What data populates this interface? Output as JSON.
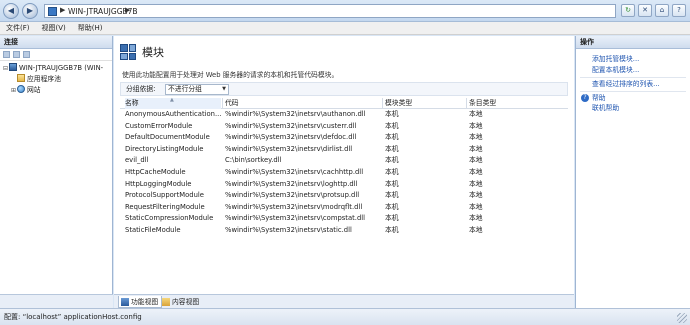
{
  "address": {
    "path": "WIN-JTRAUJGGB7B",
    "separator": "▶",
    "trailing_separator": "▶"
  },
  "menu": [
    "文件(F)",
    "视图(V)",
    "帮助(H)"
  ],
  "connections": {
    "header": "连接",
    "tree": [
      {
        "label": "WIN-JTRAUJGGB7B (WIN-",
        "expander": "⊟",
        "icon": "server-icon"
      },
      {
        "label": "应用程序池",
        "expander": "",
        "icon": "folder-icon"
      },
      {
        "label": "网站",
        "expander": "⊞",
        "icon": "sites-icon"
      }
    ]
  },
  "main": {
    "title": "模块",
    "description": "使用此功能配置用于处理对 Web 服务器的请求的本机和托管代码模块。",
    "group_by_label": "分组依据:",
    "group_by_value": "不进行分组",
    "columns": [
      "名称",
      "代码",
      "模块类型",
      "条目类型"
    ],
    "rows": [
      [
        "AnonymousAuthentication...",
        "%windir%\\System32\\inetsrv\\authanon.dll",
        "本机",
        "本地"
      ],
      [
        "CustomErrorModule",
        "%windir%\\System32\\inetsrv\\custerr.dll",
        "本机",
        "本地"
      ],
      [
        "DefaultDocumentModule",
        "%windir%\\System32\\inetsrv\\defdoc.dll",
        "本机",
        "本地"
      ],
      [
        "DirectoryListingModule",
        "%windir%\\System32\\inetsrv\\dirlist.dll",
        "本机",
        "本地"
      ],
      [
        "evil_dll",
        "C:\\bin\\sortkey.dll",
        "本机",
        "本地"
      ],
      [
        "HttpCacheModule",
        "%windir%\\System32\\inetsrv\\cachhttp.dll",
        "本机",
        "本地"
      ],
      [
        "HttpLoggingModule",
        "%windir%\\System32\\inetsrv\\loghttp.dll",
        "本机",
        "本地"
      ],
      [
        "ProtocolSupportModule",
        "%windir%\\System32\\inetsrv\\protsup.dll",
        "本机",
        "本地"
      ],
      [
        "RequestFilteringModule",
        "%windir%\\System32\\inetsrv\\modrqflt.dll",
        "本机",
        "本地"
      ],
      [
        "StaticCompressionModule",
        "%windir%\\System32\\inetsrv\\compstat.dll",
        "本机",
        "本地"
      ],
      [
        "StaticFileModule",
        "%windir%\\System32\\inetsrv\\static.dll",
        "本机",
        "本地"
      ]
    ]
  },
  "view_tabs": [
    "功能视图",
    "内容视图"
  ],
  "actions": {
    "header": "操作",
    "links": [
      "添加托管模块...",
      "配置本机模块...",
      "查看经过排序的列表...",
      "帮助",
      "联机帮助"
    ]
  },
  "status": {
    "text": "配置: “localhost” applicationHost.config"
  },
  "colors": {
    "link": "#1f55b0",
    "chrome": "#d9e6f5"
  }
}
